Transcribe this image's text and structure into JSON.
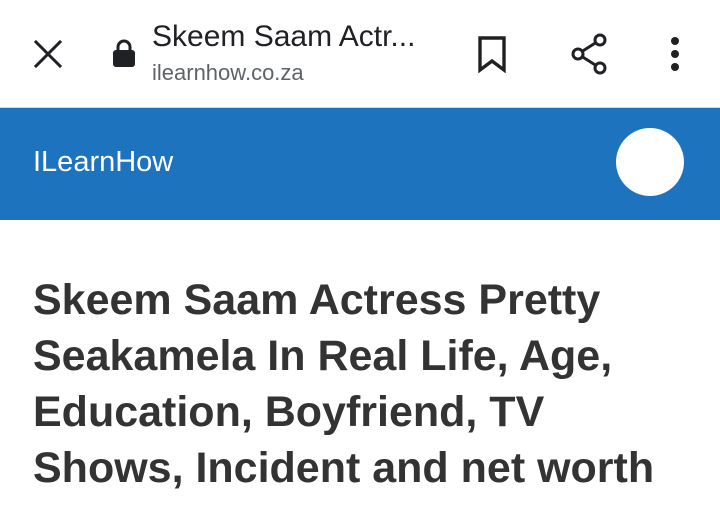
{
  "browser": {
    "page_title": "Skeem Saam Actr...",
    "url": "ilearnhow.co.za",
    "icons": [
      "close-icon",
      "lock-icon",
      "bookmark-icon",
      "share-icon",
      "more-vert-icon"
    ]
  },
  "site": {
    "name": "ILearnHow",
    "header_color": "#1e73be"
  },
  "article": {
    "title": "Skeem Saam Actress Pretty Seakamela In Real Life, Age, Education, Boyfriend, TV Shows, Incident and net worth"
  }
}
